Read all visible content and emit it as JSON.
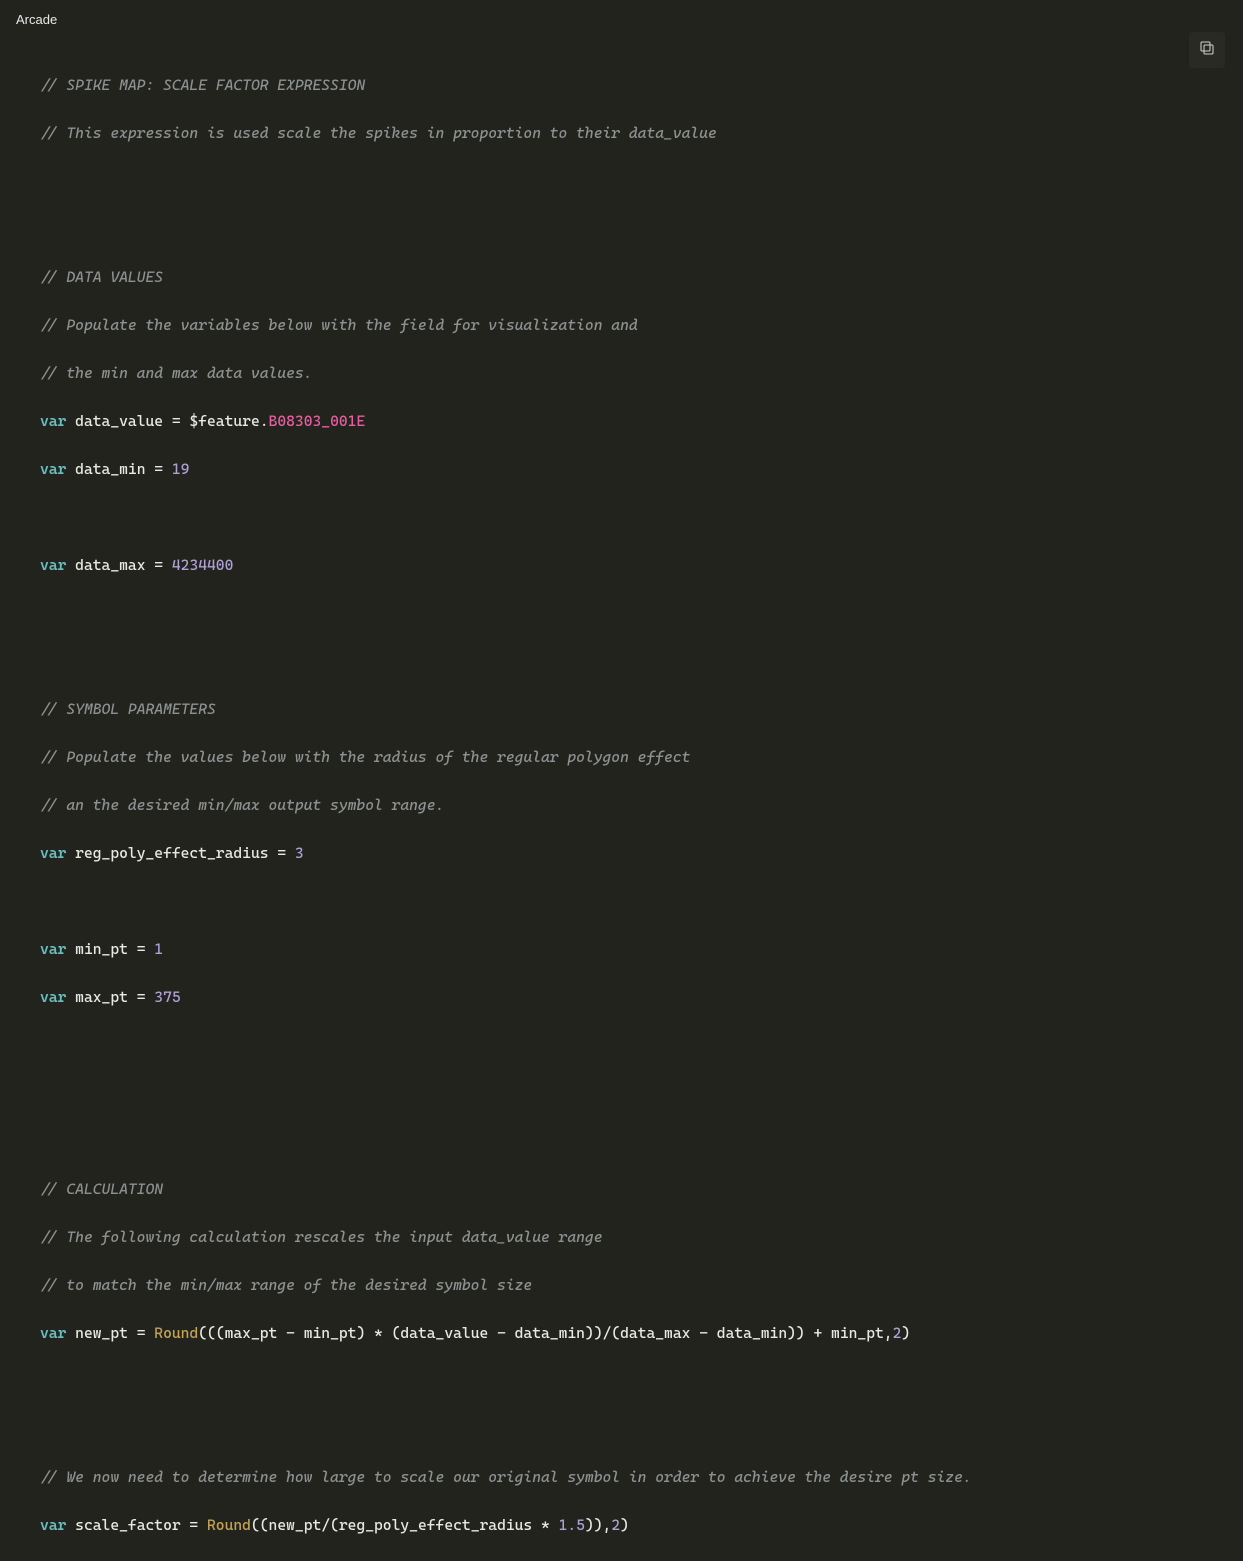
{
  "header": {
    "title": "Arcade"
  },
  "code": {
    "c1": "// SPIKE MAP: SCALE FACTOR EXPRESSION",
    "c2": "// This expression is used scale the spikes in proportion to their data_value",
    "c3": "// DATA VALUES",
    "c4": "// Populate the variables below with the field for visualization and",
    "c5": "// the min and max data values.",
    "kw_var": "var",
    "id_data_value": "data_value",
    "eq": " = ",
    "feature": "$feature.",
    "prop_b08": "B08303_001E",
    "id_data_min": "data_min",
    "num_19": "19",
    "id_data_max": "data_max",
    "num_4234400": "4234400",
    "c6": "// SYMBOL PARAMETERS",
    "c7": "// Populate the values below with the radius of the regular polygon effect",
    "c8": "// an the desired min/max output symbol range.",
    "id_reg_poly": "reg_poly_effect_radius",
    "num_3": "3",
    "id_min_pt": "min_pt",
    "num_1": "1",
    "id_max_pt": "max_pt",
    "num_375": "375",
    "c9": "// CALCULATION",
    "c10": "// The following calculation rescales the input data_value range",
    "c11": "// to match the min/max range of the desired symbol size",
    "id_new_pt": "new_pt",
    "fn_round": "Round",
    "calc1_a": "(((max_pt - min_pt) * (data_value - data_min))/(data_max - data_min)) + min_pt,",
    "num_2": "2",
    "paren_close": ")",
    "c12": "// We now need to determine how large to scale our original symbol in order to achieve the desire pt size.",
    "id_scale_factor": "scale_factor",
    "calc2_a": "((new_pt/(reg_poly_effect_radius * ",
    "num_1_5": "1.5",
    "calc2_b": ")),"
  }
}
